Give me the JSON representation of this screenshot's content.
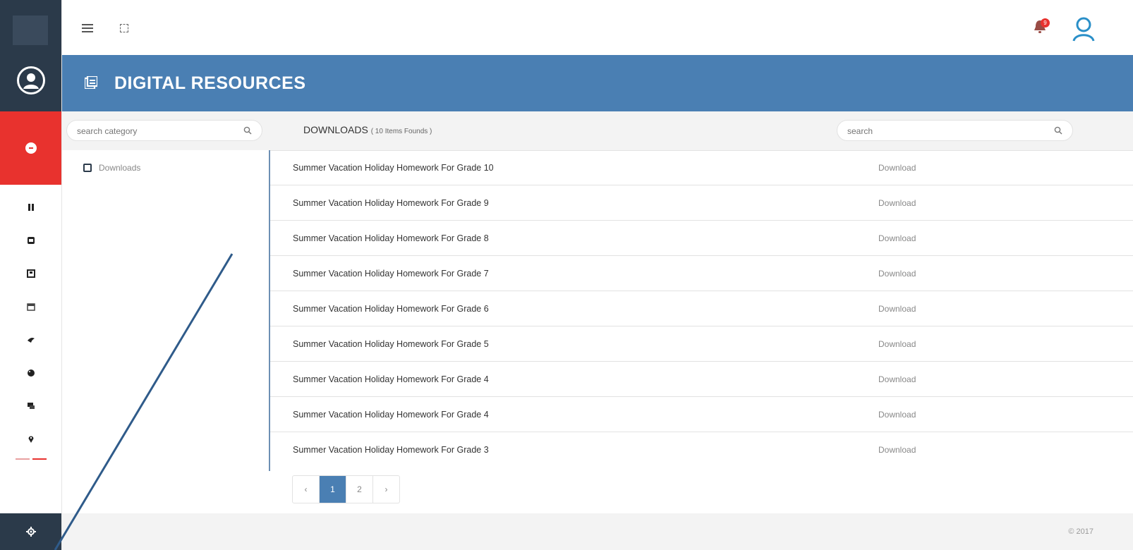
{
  "header": {
    "notification_count": "9"
  },
  "banner": {
    "title": "DIGITAL RESOURCES"
  },
  "category": {
    "search_placeholder": "search category",
    "items": [
      {
        "label": "Downloads"
      }
    ]
  },
  "downloads": {
    "title": "DOWNLOADS",
    "count_text": "( 10 Items Founds )",
    "search_placeholder": "search",
    "action_label": "Download",
    "rows": [
      {
        "name": "Summer Vacation Holiday Homework For Grade 10"
      },
      {
        "name": "Summer Vacation Holiday Homework For Grade 9"
      },
      {
        "name": "Summer Vacation Holiday Homework For Grade 8"
      },
      {
        "name": "Summer Vacation Holiday Homework For Grade 7"
      },
      {
        "name": "Summer Vacation Holiday Homework For Grade 6"
      },
      {
        "name": "Summer Vacation Holiday Homework For Grade 5"
      },
      {
        "name": "Summer Vacation Holiday Homework For Grade 4"
      },
      {
        "name": "Summer Vacation Holiday Homework For Grade 4"
      },
      {
        "name": "Summer Vacation Holiday Homework For Grade 3"
      }
    ]
  },
  "pagination": {
    "prev": "‹",
    "pages": [
      "1",
      "2"
    ],
    "next": "›",
    "active": "1"
  },
  "footer": {
    "copyright": "© 2017"
  },
  "colors": {
    "banner": "#4a7fb3",
    "sidebar_dark": "#2b3a4a",
    "logout_red": "#e8322e",
    "annotation_line": "#2f5b8a"
  },
  "sidebar": {
    "icons": [
      "pause-icon",
      "note-icon",
      "book-icon",
      "calendar-icon",
      "bird-icon",
      "palette-icon",
      "chat-icon",
      "location-icon"
    ]
  }
}
